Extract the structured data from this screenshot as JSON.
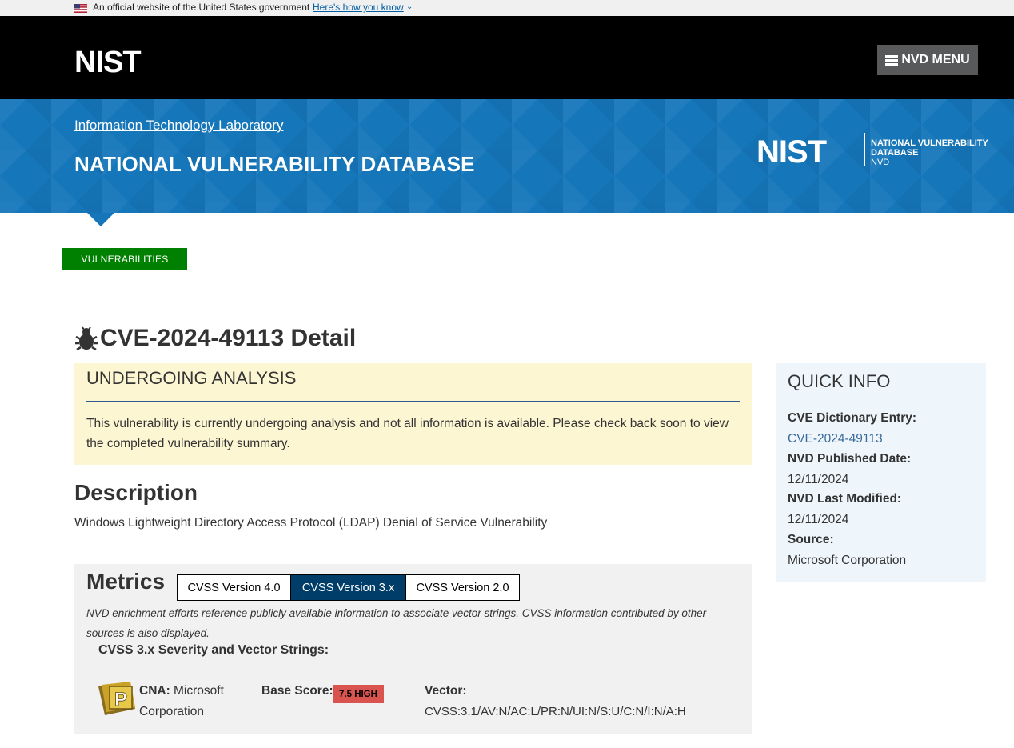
{
  "gov_banner": {
    "official_text": "An official website of the United States government",
    "how_link": "Here's how you know"
  },
  "header": {
    "logo_text": "NIST",
    "menu_label": "NVD MENU"
  },
  "banner": {
    "itl_link": "Information Technology Laboratory",
    "title": "NATIONAL VULNERABILITY DATABASE",
    "logo_text": "NIST",
    "logo_line1": "NATIONAL VULNERABILITY",
    "logo_line2": "DATABASE",
    "logo_line3": "NVD"
  },
  "nav": {
    "vulnerabilities": "VULNERABILITIES"
  },
  "page": {
    "title": "CVE-2024-49113 Detail"
  },
  "analysis": {
    "heading": "UNDERGOING ANALYSIS",
    "text": "This vulnerability is currently undergoing analysis and not all information is available. Please check back soon to view the completed vulnerability summary."
  },
  "description": {
    "heading": "Description",
    "text": "Windows Lightweight Directory Access Protocol (LDAP) Denial of Service Vulnerability"
  },
  "metrics": {
    "heading": "Metrics",
    "tabs": [
      "CVSS Version 4.0",
      "CVSS Version 3.x",
      "CVSS Version 2.0"
    ],
    "active_tab": "CVSS Version 3.x",
    "note": "NVD enrichment efforts reference publicly available information to associate vector strings. CVSS information contributed by other sources is also displayed.",
    "severity_heading": "CVSS 3.x Severity and Vector Strings:",
    "cna_badge_letter": "P",
    "cna_label": "CNA:",
    "cna_name_1": "Microsoft",
    "cna_name_2": "Corporation",
    "base_score_label": "Base Score:",
    "base_score": "7.5 HIGH",
    "vector_label": "Vector:",
    "vector": "CVSS:3.1/AV:N/AC:L/PR:N/UI:N/S:U/C:N/I:N/A:H"
  },
  "quick_info": {
    "heading": "QUICK INFO",
    "cve_label": "CVE Dictionary Entry:",
    "cve_value": "CVE-2024-49113",
    "published_label": "NVD Published Date:",
    "published_value": "12/11/2024",
    "modified_label": "NVD Last Modified:",
    "modified_value": "12/11/2024",
    "source_label": "Source:",
    "source_value": "Microsoft Corporation"
  },
  "colors": {
    "header_bg": "#000000",
    "banner_blue": "#1576b9",
    "vuln_green": "#008000",
    "analysis_bg": "#fdf6d2",
    "quick_info_bg": "#eef6fc",
    "active_tab": "#003e69",
    "high_badge": "#d9534f"
  }
}
